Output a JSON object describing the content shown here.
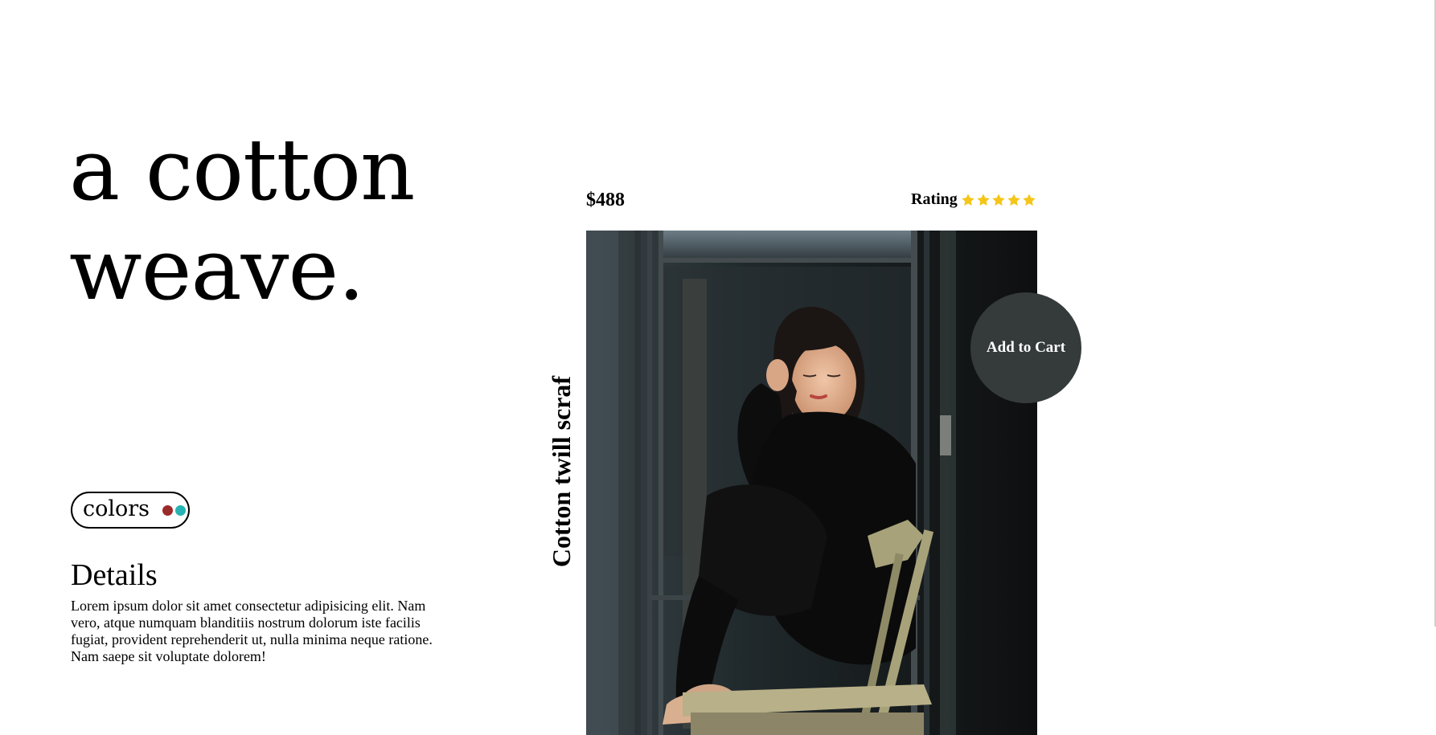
{
  "hero": {
    "line1": "a cotton",
    "line2": "weave."
  },
  "colors": {
    "label": "colors",
    "options": [
      {
        "name": "dark red",
        "hex": "#9b2a2a"
      },
      {
        "name": "teal",
        "hex": "#27b3b3"
      }
    ]
  },
  "details": {
    "heading": "Details",
    "text": "Lorem ipsum dolor sit amet consectetur adipisicing elit. Nam vero, atque numquam blanditiis nostrum dolorum iste facilis fugiat, provident reprehenderit ut, nulla minima neque ratione. Nam saepe sit voluptate dolorem!"
  },
  "product": {
    "name": "Cotton twill scraf",
    "price": "$488",
    "rating_label": "Rating",
    "rating_stars": 5,
    "rating_max": 5,
    "star_color": "#f5c518",
    "cart_label": "Add to Cart",
    "cart_color": "#353a3a"
  }
}
